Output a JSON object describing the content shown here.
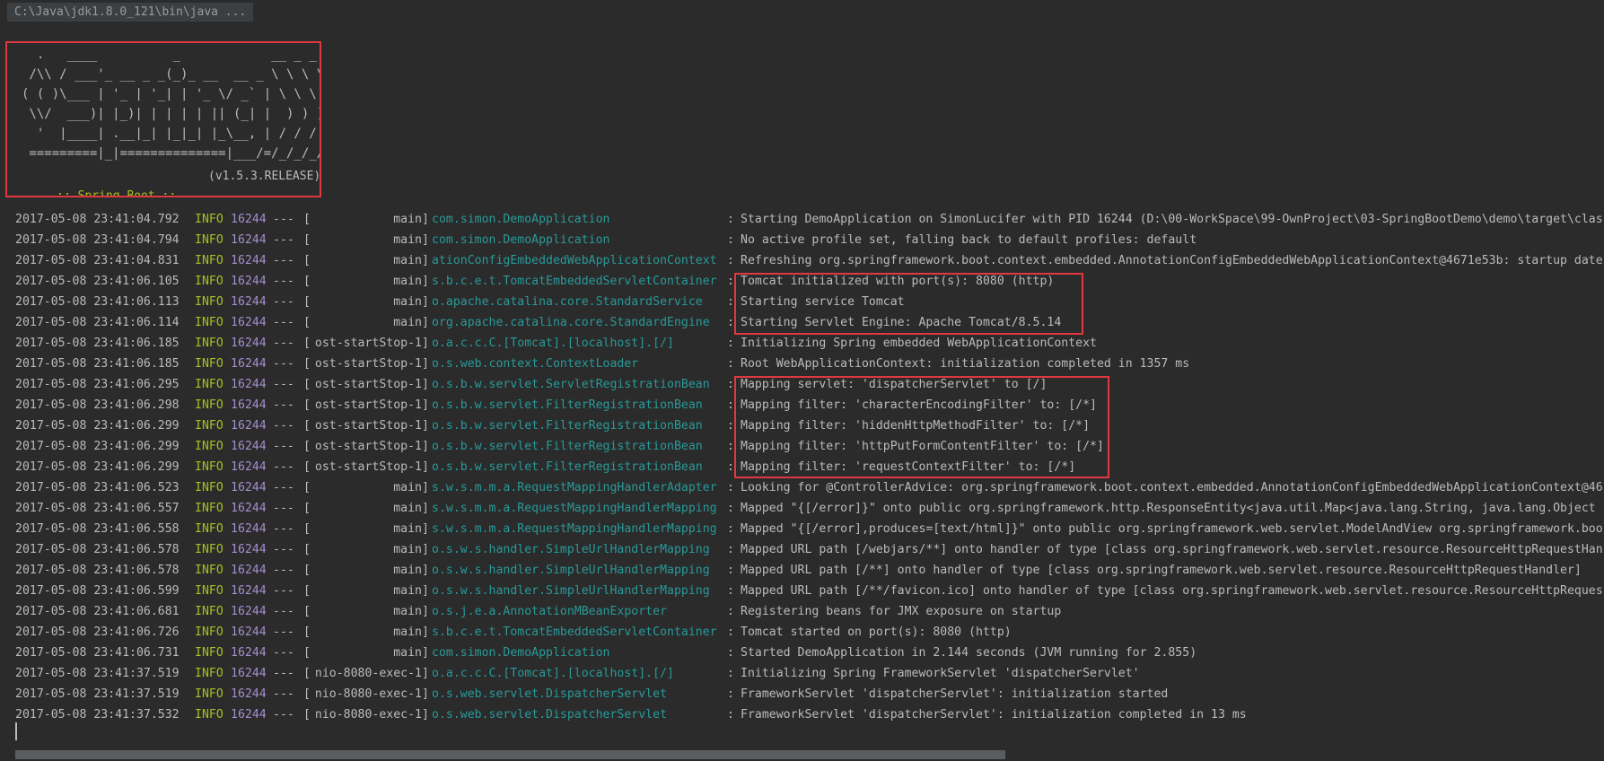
{
  "console": {
    "command": "C:\\Java\\jdk1.8.0_121\\bin\\java ..."
  },
  "banner": {
    "lines": [
      "  .   ____          _            __ _ _",
      " /\\\\ / ___'_ __ _ _(_)_ __  __ _ \\ \\ \\ \\",
      "( ( )\\___ | '_ | '_| | '_ \\/ _` | \\ \\ \\ \\",
      " \\\\/  ___)| |_)| | | | | || (_| |  ) ) ) )",
      "  '  |____| .__|_| |_|_| |_\\__, | / / / /",
      " =========|_|==============|___/=/_/_/_/"
    ],
    "tag": " :: Spring Boot :: ",
    "version": "(v1.5.3.RELEASE)"
  },
  "log": [
    {
      "ts": "2017-05-08 23:41:04.792",
      "level": "INFO",
      "pid": "16244",
      "sep": "---",
      "thread": "main",
      "logger": "com.simon.DemoApplication",
      "msg": "Starting DemoApplication on SimonLucifer with PID 16244 (D:\\00-WorkSpace\\99-OwnProject\\03-SpringBootDemo\\demo\\target\\clas"
    },
    {
      "ts": "2017-05-08 23:41:04.794",
      "level": "INFO",
      "pid": "16244",
      "sep": "---",
      "thread": "main",
      "logger": "com.simon.DemoApplication",
      "msg": "No active profile set, falling back to default profiles: default"
    },
    {
      "ts": "2017-05-08 23:41:04.831",
      "level": "INFO",
      "pid": "16244",
      "sep": "---",
      "thread": "main",
      "logger": "ationConfigEmbeddedWebApplicationContext",
      "msg": "Refreshing org.springframework.boot.context.embedded.AnnotationConfigEmbeddedWebApplicationContext@4671e53b: startup date"
    },
    {
      "ts": "2017-05-08 23:41:06.105",
      "level": "INFO",
      "pid": "16244",
      "sep": "---",
      "thread": "main",
      "logger": "s.b.c.e.t.TomcatEmbeddedServletContainer",
      "msg": "Tomcat initialized with port(s): 8080 (http)"
    },
    {
      "ts": "2017-05-08 23:41:06.113",
      "level": "INFO",
      "pid": "16244",
      "sep": "---",
      "thread": "main",
      "logger": "o.apache.catalina.core.StandardService",
      "msg": "Starting service Tomcat"
    },
    {
      "ts": "2017-05-08 23:41:06.114",
      "level": "INFO",
      "pid": "16244",
      "sep": "---",
      "thread": "main",
      "logger": "org.apache.catalina.core.StandardEngine",
      "msg": "Starting Servlet Engine: Apache Tomcat/8.5.14"
    },
    {
      "ts": "2017-05-08 23:41:06.185",
      "level": "INFO",
      "pid": "16244",
      "sep": "---",
      "thread": "ost-startStop-1",
      "logger": "o.a.c.c.C.[Tomcat].[localhost].[/]",
      "msg": "Initializing Spring embedded WebApplicationContext"
    },
    {
      "ts": "2017-05-08 23:41:06.185",
      "level": "INFO",
      "pid": "16244",
      "sep": "---",
      "thread": "ost-startStop-1",
      "logger": "o.s.web.context.ContextLoader",
      "msg": "Root WebApplicationContext: initialization completed in 1357 ms"
    },
    {
      "ts": "2017-05-08 23:41:06.295",
      "level": "INFO",
      "pid": "16244",
      "sep": "---",
      "thread": "ost-startStop-1",
      "logger": "o.s.b.w.servlet.ServletRegistrationBean",
      "msg": "Mapping servlet: 'dispatcherServlet' to [/]"
    },
    {
      "ts": "2017-05-08 23:41:06.298",
      "level": "INFO",
      "pid": "16244",
      "sep": "---",
      "thread": "ost-startStop-1",
      "logger": "o.s.b.w.servlet.FilterRegistrationBean",
      "msg": "Mapping filter: 'characterEncodingFilter' to: [/*]"
    },
    {
      "ts": "2017-05-08 23:41:06.299",
      "level": "INFO",
      "pid": "16244",
      "sep": "---",
      "thread": "ost-startStop-1",
      "logger": "o.s.b.w.servlet.FilterRegistrationBean",
      "msg": "Mapping filter: 'hiddenHttpMethodFilter' to: [/*]"
    },
    {
      "ts": "2017-05-08 23:41:06.299",
      "level": "INFO",
      "pid": "16244",
      "sep": "---",
      "thread": "ost-startStop-1",
      "logger": "o.s.b.w.servlet.FilterRegistrationBean",
      "msg": "Mapping filter: 'httpPutFormContentFilter' to: [/*]"
    },
    {
      "ts": "2017-05-08 23:41:06.299",
      "level": "INFO",
      "pid": "16244",
      "sep": "---",
      "thread": "ost-startStop-1",
      "logger": "o.s.b.w.servlet.FilterRegistrationBean",
      "msg": "Mapping filter: 'requestContextFilter' to: [/*]"
    },
    {
      "ts": "2017-05-08 23:41:06.523",
      "level": "INFO",
      "pid": "16244",
      "sep": "---",
      "thread": "main",
      "logger": "s.w.s.m.m.a.RequestMappingHandlerAdapter",
      "msg": "Looking for @ControllerAdvice: org.springframework.boot.context.embedded.AnnotationConfigEmbeddedWebApplicationContext@46"
    },
    {
      "ts": "2017-05-08 23:41:06.557",
      "level": "INFO",
      "pid": "16244",
      "sep": "---",
      "thread": "main",
      "logger": "s.w.s.m.m.a.RequestMappingHandlerMapping",
      "msg": "Mapped \"{[/error]}\" onto public org.springframework.http.ResponseEntity<java.util.Map<java.lang.String, java.lang.Object"
    },
    {
      "ts": "2017-05-08 23:41:06.558",
      "level": "INFO",
      "pid": "16244",
      "sep": "---",
      "thread": "main",
      "logger": "s.w.s.m.m.a.RequestMappingHandlerMapping",
      "msg": "Mapped \"{[/error],produces=[text/html]}\" onto public org.springframework.web.servlet.ModelAndView org.springframework.boo"
    },
    {
      "ts": "2017-05-08 23:41:06.578",
      "level": "INFO",
      "pid": "16244",
      "sep": "---",
      "thread": "main",
      "logger": "o.s.w.s.handler.SimpleUrlHandlerMapping",
      "msg": "Mapped URL path [/webjars/**] onto handler of type [class org.springframework.web.servlet.resource.ResourceHttpRequestHan"
    },
    {
      "ts": "2017-05-08 23:41:06.578",
      "level": "INFO",
      "pid": "16244",
      "sep": "---",
      "thread": "main",
      "logger": "o.s.w.s.handler.SimpleUrlHandlerMapping",
      "msg": "Mapped URL path [/**] onto handler of type [class org.springframework.web.servlet.resource.ResourceHttpRequestHandler]"
    },
    {
      "ts": "2017-05-08 23:41:06.599",
      "level": "INFO",
      "pid": "16244",
      "sep": "---",
      "thread": "main",
      "logger": "o.s.w.s.handler.SimpleUrlHandlerMapping",
      "msg": "Mapped URL path [/**/favicon.ico] onto handler of type [class org.springframework.web.servlet.resource.ResourceHttpReques"
    },
    {
      "ts": "2017-05-08 23:41:06.681",
      "level": "INFO",
      "pid": "16244",
      "sep": "---",
      "thread": "main",
      "logger": "o.s.j.e.a.AnnotationMBeanExporter",
      "msg": "Registering beans for JMX exposure on startup"
    },
    {
      "ts": "2017-05-08 23:41:06.726",
      "level": "INFO",
      "pid": "16244",
      "sep": "---",
      "thread": "main",
      "logger": "s.b.c.e.t.TomcatEmbeddedServletContainer",
      "msg": "Tomcat started on port(s): 8080 (http)"
    },
    {
      "ts": "2017-05-08 23:41:06.731",
      "level": "INFO",
      "pid": "16244",
      "sep": "---",
      "thread": "main",
      "logger": "com.simon.DemoApplication",
      "msg": "Started DemoApplication in 2.144 seconds (JVM running for 2.855)"
    },
    {
      "ts": "2017-05-08 23:41:37.519",
      "level": "INFO",
      "pid": "16244",
      "sep": "---",
      "thread": "nio-8080-exec-1",
      "logger": "o.a.c.c.C.[Tomcat].[localhost].[/]",
      "msg": "Initializing Spring FrameworkServlet 'dispatcherServlet'"
    },
    {
      "ts": "2017-05-08 23:41:37.519",
      "level": "INFO",
      "pid": "16244",
      "sep": "---",
      "thread": "nio-8080-exec-1",
      "logger": "o.s.web.servlet.DispatcherServlet",
      "msg": "FrameworkServlet 'dispatcherServlet': initialization started"
    },
    {
      "ts": "2017-05-08 23:41:37.532",
      "level": "INFO",
      "pid": "16244",
      "sep": "---",
      "thread": "nio-8080-exec-1",
      "logger": "o.s.web.servlet.DispatcherServlet",
      "msg": "FrameworkServlet 'dispatcherServlet': initialization completed in 13 ms"
    }
  ]
}
